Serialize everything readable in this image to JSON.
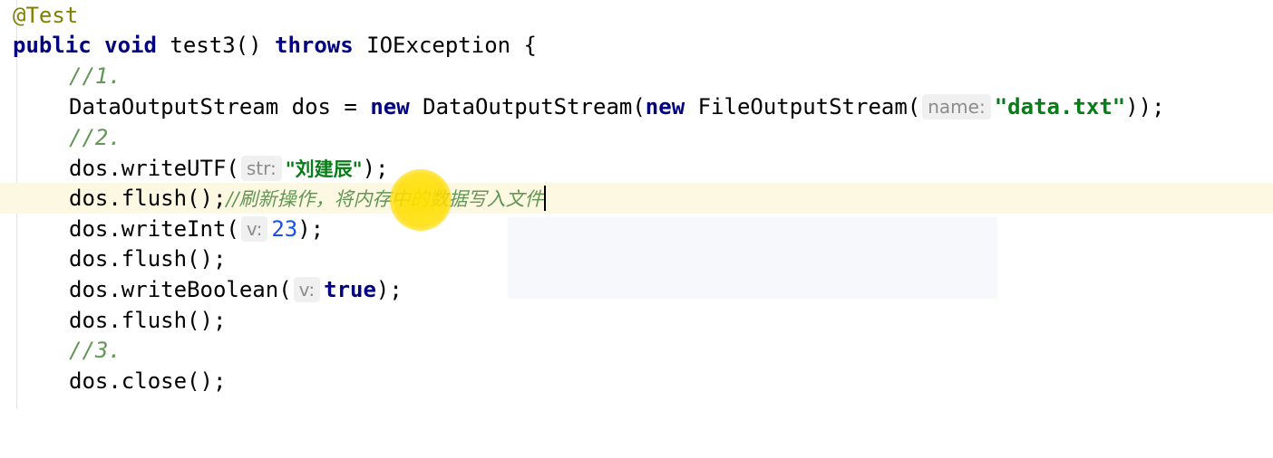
{
  "editor": {
    "lines": {
      "l1": {
        "annotation": "@Test"
      },
      "l2": {
        "kw_public": "public",
        "kw_void": "void",
        "method": " test3() ",
        "kw_throws": "throws",
        "rest": " IOException {"
      },
      "l3": {
        "comment": "//1."
      },
      "l4": {
        "pre": "DataOutputStream dos = ",
        "kw_new1": "new",
        "mid": " DataOutputStream(",
        "kw_new2": "new",
        "post": " FileOutputStream(",
        "hint": "name:",
        "str": "\"data.txt\"",
        "end": "));"
      },
      "l5": {
        "comment": "//2."
      },
      "l6": {
        "pre": "dos.writeUTF(",
        "hint": "str:",
        "str": "\"刘建辰\"",
        "end": ");"
      },
      "l7": {
        "code": "dos.flush();",
        "comment": "//刷新操作，将内存中的数据写入文件"
      },
      "l8": {
        "pre": "dos.writeInt(",
        "hint": "v:",
        "num": "23",
        "end": ");"
      },
      "l9": {
        "code": "dos.flush();"
      },
      "l10": {
        "pre": "dos.writeBoolean(",
        "hint": "v:",
        "kw": "true",
        "end": ");"
      },
      "l11": {
        "code": "dos.flush();"
      },
      "l12": {
        "comment": "//3."
      },
      "l13": {
        "code": "dos.close();"
      }
    }
  },
  "colors": {
    "keyword": "#000080",
    "annotation": "#808000",
    "comment": "#629755",
    "string": "#067d17",
    "number": "#1750eb",
    "current_line": "#fdf8e2"
  }
}
